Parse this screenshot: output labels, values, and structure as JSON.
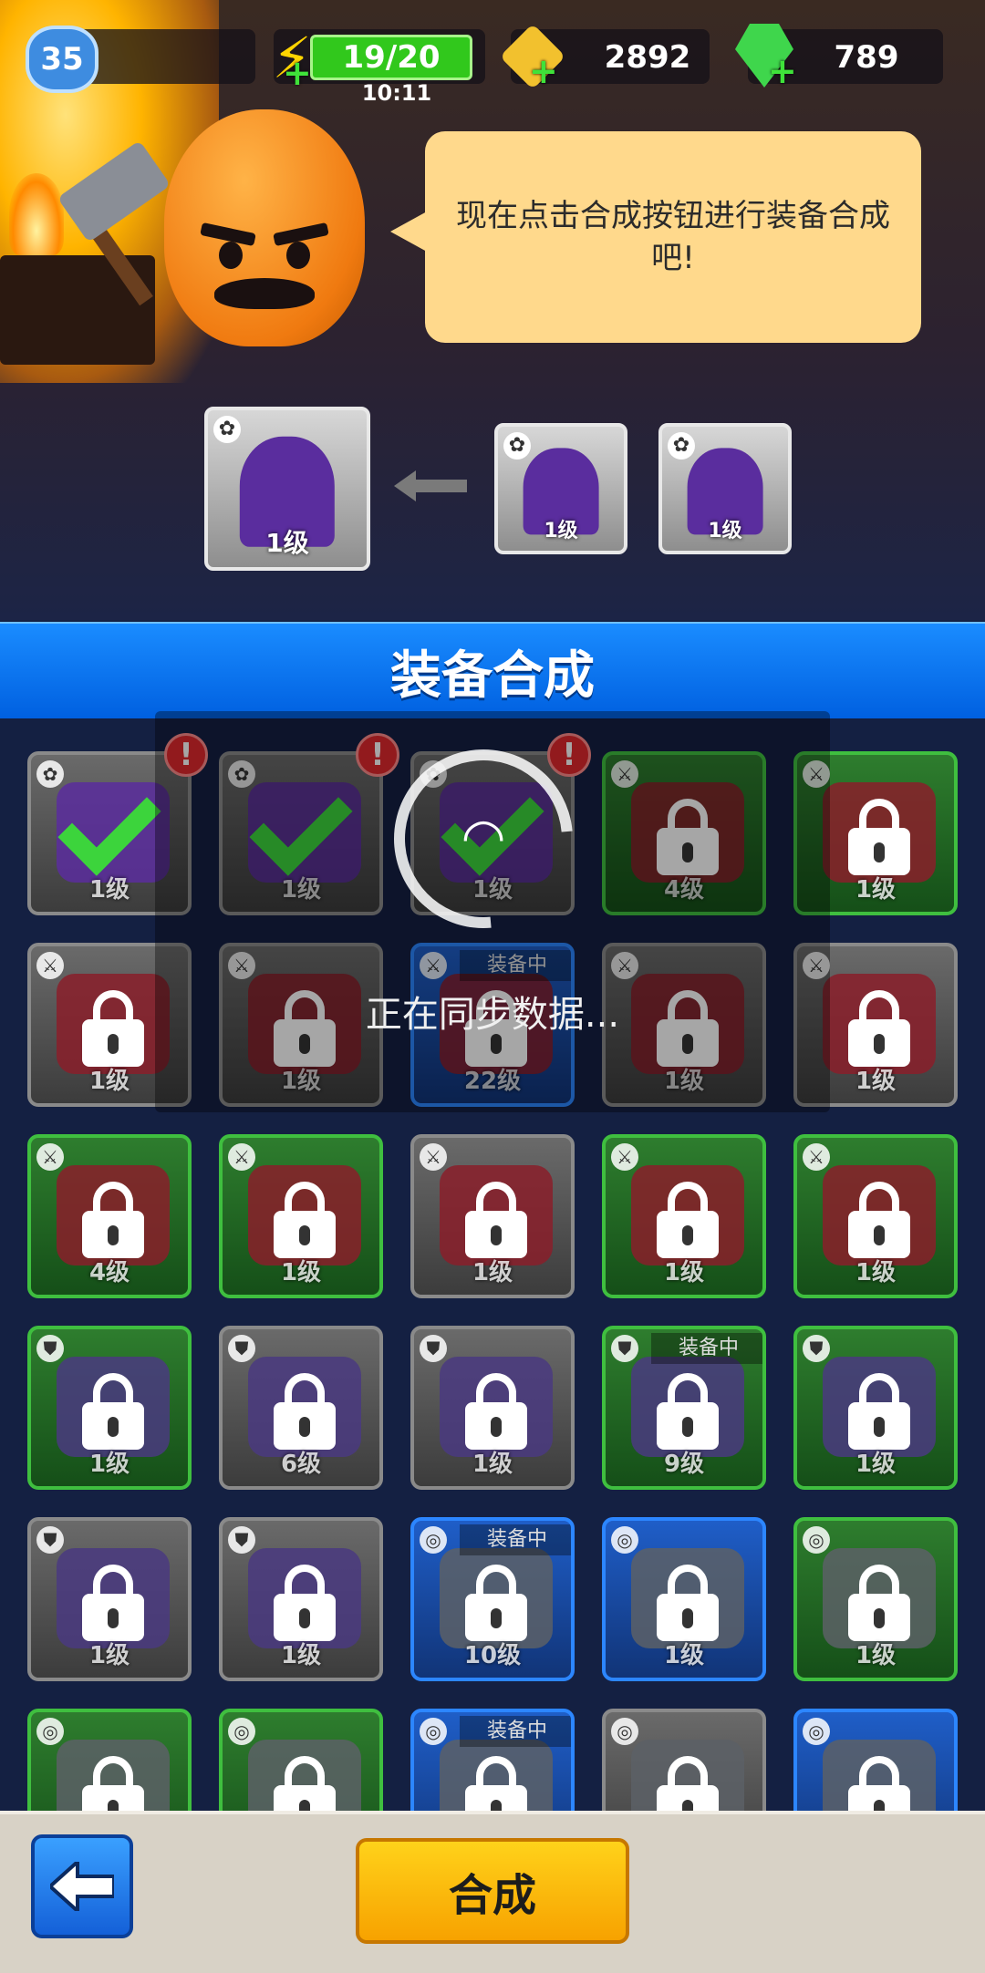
{
  "hud": {
    "level": "35",
    "energy": "19/20",
    "energy_timer": "10:11",
    "gold": "2892",
    "gems": "789"
  },
  "dialog": {
    "message": "现在点击合成按钮进行装备合成吧!"
  },
  "merge_preview": {
    "result": {
      "level": "1级",
      "icon": "paw-icon"
    },
    "inputs": [
      {
        "level": "1级",
        "icon": "paw-icon"
      },
      {
        "level": "1级",
        "icon": "paw-icon"
      }
    ]
  },
  "panel": {
    "title": "装备合成"
  },
  "sync": {
    "text": "正在同步数据..."
  },
  "grid": {
    "equipped_label": "装备中",
    "cells": [
      {
        "level": "1级",
        "rarity": "gray",
        "slot": "paw",
        "state": "check",
        "alert": true
      },
      {
        "level": "1级",
        "rarity": "gray",
        "slot": "paw",
        "state": "check",
        "alert": true
      },
      {
        "level": "1级",
        "rarity": "gray",
        "slot": "paw",
        "state": "check",
        "alert": true
      },
      {
        "level": "4级",
        "rarity": "green",
        "slot": "weapon",
        "state": "lock"
      },
      {
        "level": "1级",
        "rarity": "green",
        "slot": "weapon",
        "state": "lock"
      },
      {
        "level": "1级",
        "rarity": "gray",
        "slot": "weapon",
        "state": "lock"
      },
      {
        "level": "1级",
        "rarity": "gray",
        "slot": "weapon",
        "state": "lock"
      },
      {
        "level": "22级",
        "rarity": "blue",
        "slot": "weapon",
        "state": "lock",
        "equipped": true
      },
      {
        "level": "1级",
        "rarity": "gray",
        "slot": "weapon",
        "state": "lock"
      },
      {
        "level": "1级",
        "rarity": "gray",
        "slot": "weapon",
        "state": "lock"
      },
      {
        "level": "4级",
        "rarity": "green",
        "slot": "weapon",
        "state": "lock"
      },
      {
        "level": "1级",
        "rarity": "green",
        "slot": "weapon",
        "state": "lock"
      },
      {
        "level": "1级",
        "rarity": "gray",
        "slot": "weapon",
        "state": "lock"
      },
      {
        "level": "1级",
        "rarity": "green",
        "slot": "weapon",
        "state": "lock"
      },
      {
        "level": "1级",
        "rarity": "green",
        "slot": "weapon",
        "state": "lock"
      },
      {
        "level": "1级",
        "rarity": "green",
        "slot": "armor",
        "state": "lock"
      },
      {
        "level": "6级",
        "rarity": "gray",
        "slot": "armor",
        "state": "lock"
      },
      {
        "level": "1级",
        "rarity": "gray",
        "slot": "armor",
        "state": "lock"
      },
      {
        "level": "9级",
        "rarity": "green",
        "slot": "armor",
        "state": "lock",
        "equipped": true
      },
      {
        "level": "1级",
        "rarity": "green",
        "slot": "armor",
        "state": "lock"
      },
      {
        "level": "1级",
        "rarity": "gray",
        "slot": "armor",
        "state": "lock"
      },
      {
        "level": "1级",
        "rarity": "gray",
        "slot": "armor",
        "state": "lock"
      },
      {
        "level": "10级",
        "rarity": "blue",
        "slot": "ring",
        "state": "lock",
        "equipped": true
      },
      {
        "level": "1级",
        "rarity": "blue",
        "slot": "ring",
        "state": "lock"
      },
      {
        "level": "1级",
        "rarity": "green",
        "slot": "ring",
        "state": "lock"
      },
      {
        "level": "",
        "rarity": "green",
        "slot": "ring",
        "state": "lock"
      },
      {
        "level": "",
        "rarity": "green",
        "slot": "ring",
        "state": "lock"
      },
      {
        "level": "",
        "rarity": "blue",
        "slot": "ring",
        "state": "lock",
        "equipped": true
      },
      {
        "level": "",
        "rarity": "gray",
        "slot": "ring",
        "state": "lock"
      },
      {
        "level": "",
        "rarity": "blue",
        "slot": "ring",
        "state": "lock"
      }
    ]
  },
  "buttons": {
    "merge": "合成",
    "back_icon": "arrow-left-icon"
  },
  "colors": {
    "title_bar": "#0a7cf5",
    "merge_button": "#f7b800",
    "energy_bar": "#31c81c"
  }
}
